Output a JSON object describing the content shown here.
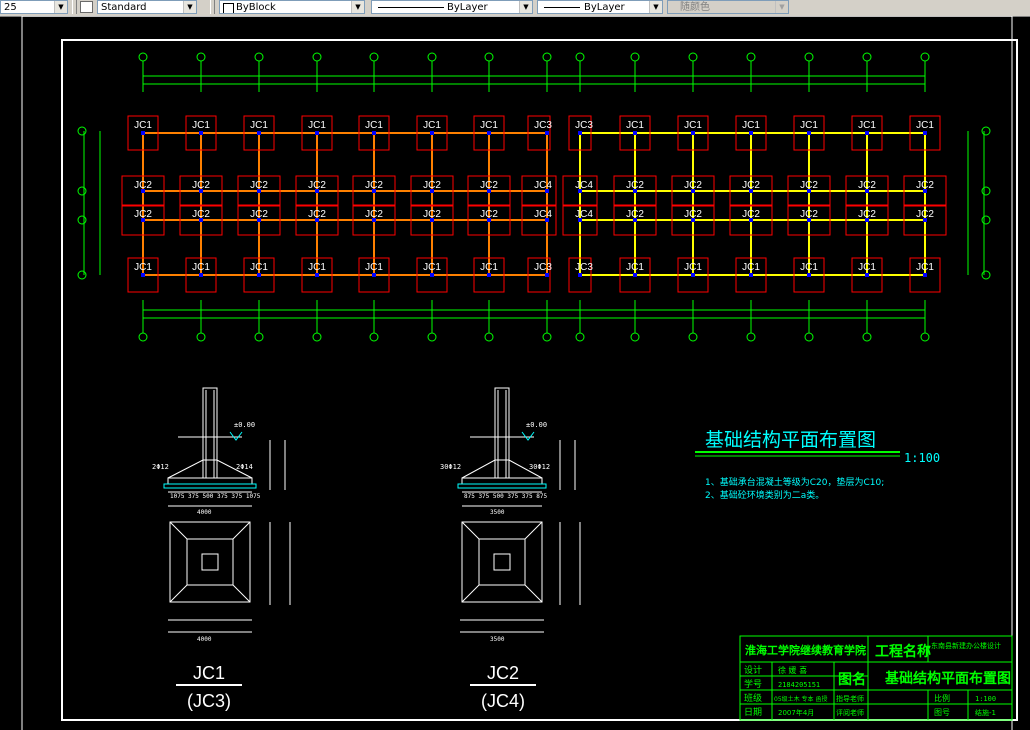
{
  "toolbar": {
    "layer_value": "25",
    "text_style": "Standard",
    "color_value": "ByBlock",
    "linetype_value": "ByLayer",
    "lineweight_value": "ByLayer",
    "plotstyle_value": "随颜色"
  },
  "plan": {
    "row_top_labels": [
      "JC1",
      "JC1",
      "JC1",
      "JC1",
      "JC1",
      "JC1",
      "JC1",
      "JC3",
      "JC3",
      "JC1",
      "JC1",
      "JC1",
      "JC1",
      "JC1",
      "JC1"
    ],
    "row_mid1_labels": [
      "JC2",
      "JC2",
      "JC2",
      "JC2",
      "JC2",
      "JC2",
      "JC2",
      "JC4",
      "JC4",
      "JC2",
      "JC2",
      "JC2",
      "JC2",
      "JC2",
      "JC2"
    ],
    "row_mid2_labels": [
      "JC2",
      "JC2",
      "JC2",
      "JC2",
      "JC2",
      "JC2",
      "JC2",
      "JC4",
      "JC4",
      "JC2",
      "JC2",
      "JC2",
      "JC2",
      "JC2",
      "JC2"
    ],
    "row_bottom_labels": [
      "JC1",
      "JC1",
      "JC1",
      "JC1",
      "JC1",
      "JC1",
      "JC1",
      "JC3",
      "JC3",
      "JC1",
      "JC1",
      "JC1",
      "JC1",
      "JC1",
      "JC1"
    ]
  },
  "drawing_title": "基础结构平面布置图",
  "drawing_scale": "1:100",
  "notes": [
    "1、基础承台混凝土等级为C20，垫层为C10;",
    "2、基础砼环境类别为二a类。"
  ],
  "detail1": {
    "elev": "±0.00",
    "left_bar": "2Φ12",
    "right_bar": "2Φ14",
    "dims": "1075 375 500 375 375 1075",
    "total": "4000",
    "label_main": "JC1",
    "label_sub": "(JC3)"
  },
  "detail2": {
    "elev": "±0.00",
    "left_bar": "30Φ12",
    "right_bar": "30Φ12",
    "dims": "875 375 500 375 375 875",
    "total": "3500",
    "label_main": "JC2",
    "label_sub": "(JC4)"
  },
  "title_block": {
    "school": "淮海工学院继续教育学院",
    "project_name_label": "工程名称",
    "project_name": "东南县新建办公楼设计",
    "design_label": "设计",
    "designer": "徐 媛 喜",
    "student_no_label": "学号",
    "student_no": "2184205151",
    "class_label": "班级",
    "class_value": "05级土木 专本 函授",
    "date_label": "日期",
    "date_value": "2007年4月",
    "drawing_name_label": "图名",
    "drawing_name": "基础结构平面布置图",
    "teacher_label": "指导老师",
    "reviewer_label": "评阅老师",
    "scale_label": "比例",
    "scale_value": "1:100",
    "drawing_no_label": "图号",
    "drawing_no": "结施-1"
  },
  "colors": {
    "frame": "#ffffff",
    "axis": "#00ff00",
    "footing": "#ff0000",
    "beam_orange": "#ff8000",
    "beam_yellow": "#ffff00",
    "label": "#ffffff",
    "cyan": "#00ffff",
    "title_block": "#00ff00"
  }
}
